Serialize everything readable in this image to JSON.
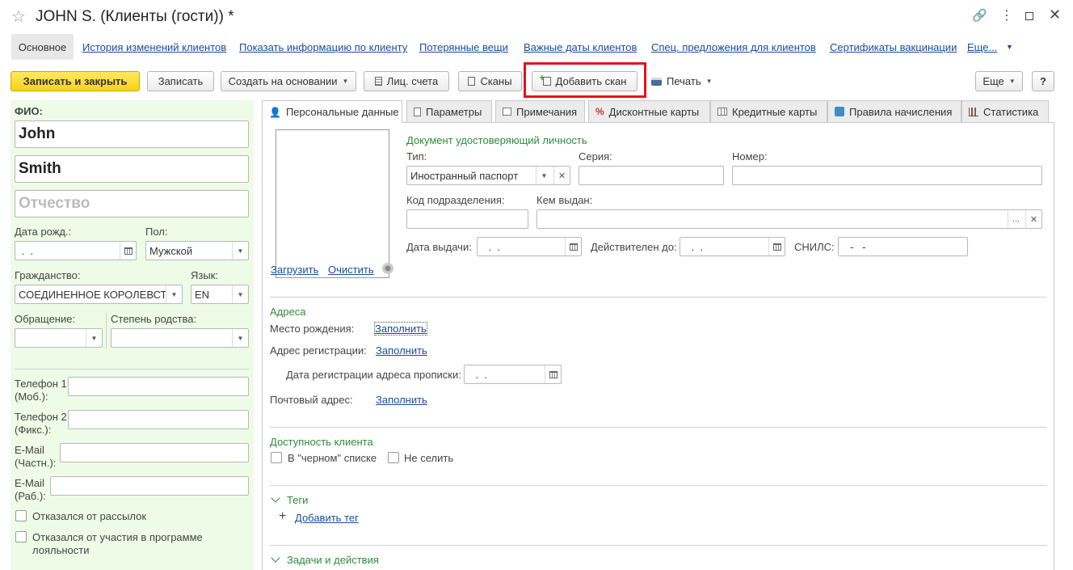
{
  "window": {
    "title": "JOHN S. (Клиенты (гости)) *"
  },
  "nav": {
    "items": [
      {
        "label": "Основное"
      },
      {
        "label": "История изменений клиентов"
      },
      {
        "label": "Показать информацию по клиенту"
      },
      {
        "label": "Потерянные вещи"
      },
      {
        "label": "Важные даты клиентов"
      },
      {
        "label": "Спец. предложения для клиентов"
      },
      {
        "label": "Сертификаты вакцинации"
      },
      {
        "label": "Еще..."
      }
    ]
  },
  "toolbar": {
    "save_close": "Записать и закрыть",
    "save": "Записать",
    "create_based": "Создать на основании",
    "accounts": "Лиц. счета",
    "scans": "Сканы",
    "add_scan": "Добавить скан",
    "print": "Печать",
    "more": "Еще",
    "help": "?"
  },
  "left": {
    "fio_label": "ФИО:",
    "first_name": "John",
    "last_name": "Smith",
    "patronymic_placeholder": "Отчество",
    "birth_label": "Дата рожд.:",
    "birth_value": " .  .",
    "gender_label": "Пол:",
    "gender_value": "Мужской",
    "citizenship_label": "Гражданство:",
    "citizenship_value": "СОЕДИНЕННОЕ КОРОЛЕВСТ",
    "language_label": "Язык:",
    "language_value": "EN",
    "salutation_label": "Обращение:",
    "kinship_label": "Степень родства:",
    "phone1_label_1": "Телефон 1",
    "phone1_label_2": "(Моб.):",
    "phone2_label_1": "Телефон 2",
    "phone2_label_2": "(Фикс.):",
    "email1_label_1": "E-Mail",
    "email1_label_2": "(Частн.):",
    "email2_label_1": "E-Mail",
    "email2_label_2": "(Раб.):",
    "refused_mailing": "Отказался от рассылок",
    "refused_loyalty_1": "Отказался от участия в программе",
    "refused_loyalty_2": "лояльности"
  },
  "tabs": [
    {
      "label": "Персональные данные"
    },
    {
      "label": "Параметры"
    },
    {
      "label": "Примечания"
    },
    {
      "label": "Дисконтные карты"
    },
    {
      "label": "Кредитные карты"
    },
    {
      "label": "Правила начисления"
    },
    {
      "label": "Статистика"
    }
  ],
  "photo": {
    "upload": "Загрузить",
    "clear": "Очистить"
  },
  "document": {
    "section_title": "Документ удостоверяющий личность",
    "type_label": "Тип:",
    "type_value": "Иностранный паспорт",
    "series_label": "Серия:",
    "number_label": "Номер:",
    "dept_code_label": "Код подразделения:",
    "issued_by_label": "Кем выдан:",
    "issue_date_label": "Дата выдачи:",
    "issue_date_value": " .  .",
    "valid_until_label": "Действителен до:",
    "valid_until_value": " .  .",
    "snils_label": "СНИЛС:",
    "snils_value": "-   -"
  },
  "addresses": {
    "title": "Адреса",
    "birthplace_label": "Место рождения:",
    "registration_label": "Адрес регистрации:",
    "reg_date_label": "Дата регистрации адреса прописки:",
    "reg_date_value": " .  .",
    "postal_label": "Почтовый адрес:",
    "fill": "Заполнить"
  },
  "availability": {
    "title": "Доступность клиента",
    "blacklist": "В \"черном\" списке",
    "no_checkin": "Не селить"
  },
  "tags": {
    "title": "Теги",
    "add": "Добавить тег"
  },
  "tasks": {
    "title": "Задачи и действия"
  }
}
